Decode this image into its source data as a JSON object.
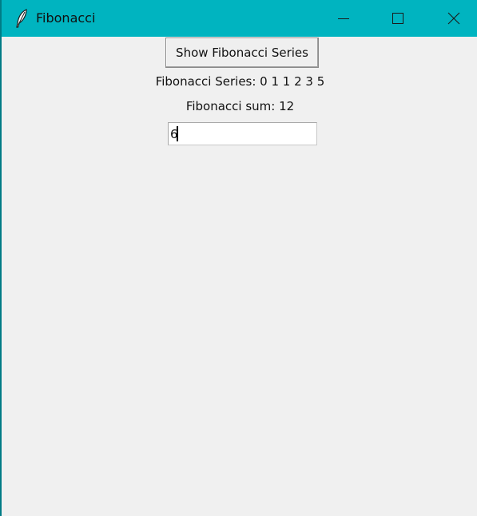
{
  "window": {
    "title": "Fibonacci",
    "icon": "feather-icon",
    "controls": [
      "minimize-icon",
      "maximize-icon",
      "close-icon"
    ]
  },
  "app": {
    "show_button_label": "Show Fibonacci Series",
    "series_text": "Fibonacci Series: 0 1 1 2 3 5",
    "sum_text": "Fibonacci sum: 12",
    "input_value": "6"
  },
  "colors": {
    "titlebar": "#00b4c0",
    "background": "#f0f0f0"
  }
}
